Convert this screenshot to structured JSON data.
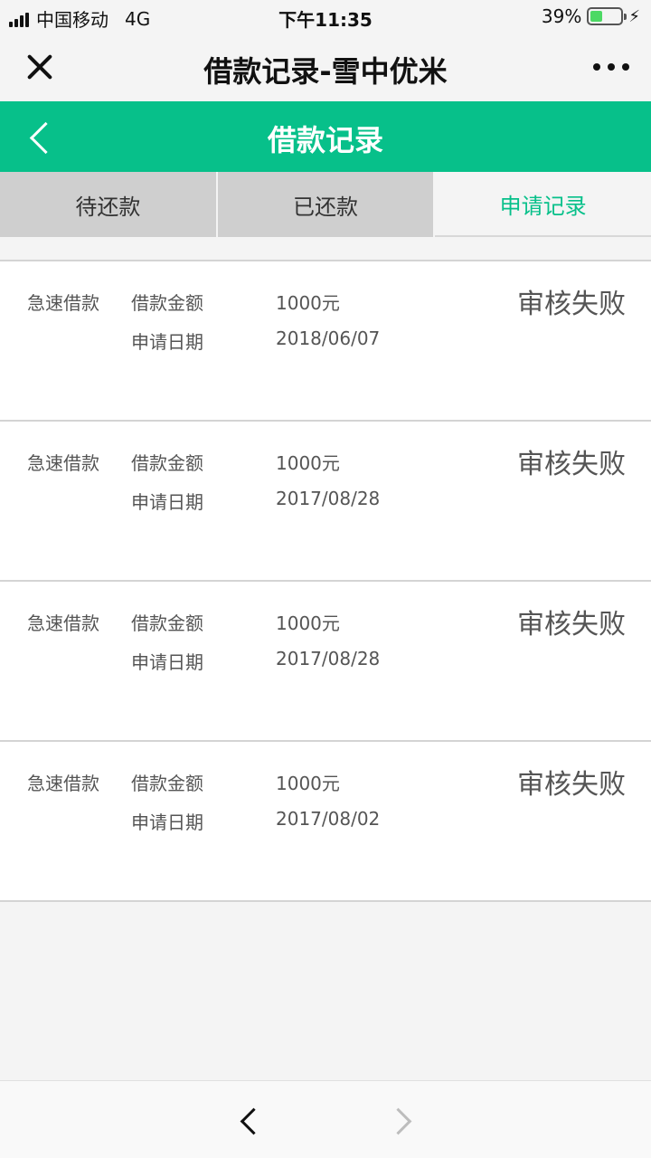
{
  "status_bar": {
    "carrier": "中国移动",
    "network": "4G",
    "time": "下午11:35",
    "battery_text": "39%",
    "battery_level": 0.39
  },
  "wechat_bar": {
    "title": "借款记录-雪中优米"
  },
  "header": {
    "title": "借款记录"
  },
  "tabs": [
    {
      "label": "待还款",
      "active": false
    },
    {
      "label": "已还款",
      "active": false
    },
    {
      "label": "申请记录",
      "active": true
    }
  ],
  "records": [
    {
      "type": "急速借款",
      "amount_label": "借款金额",
      "amount": "1000元",
      "date_label": "申请日期",
      "date": "2018/06/07",
      "status": "审核失败"
    },
    {
      "type": "急速借款",
      "amount_label": "借款金额",
      "amount": "1000元",
      "date_label": "申请日期",
      "date": "2017/08/28",
      "status": "审核失败"
    },
    {
      "type": "急速借款",
      "amount_label": "借款金额",
      "amount": "1000元",
      "date_label": "申请日期",
      "date": "2017/08/28",
      "status": "审核失败"
    },
    {
      "type": "急速借款",
      "amount_label": "借款金额",
      "amount": "1000元",
      "date_label": "申请日期",
      "date": "2017/08/02",
      "status": "审核失败"
    }
  ],
  "colors": {
    "accent": "#07c08a",
    "battery": "#4cd964"
  }
}
